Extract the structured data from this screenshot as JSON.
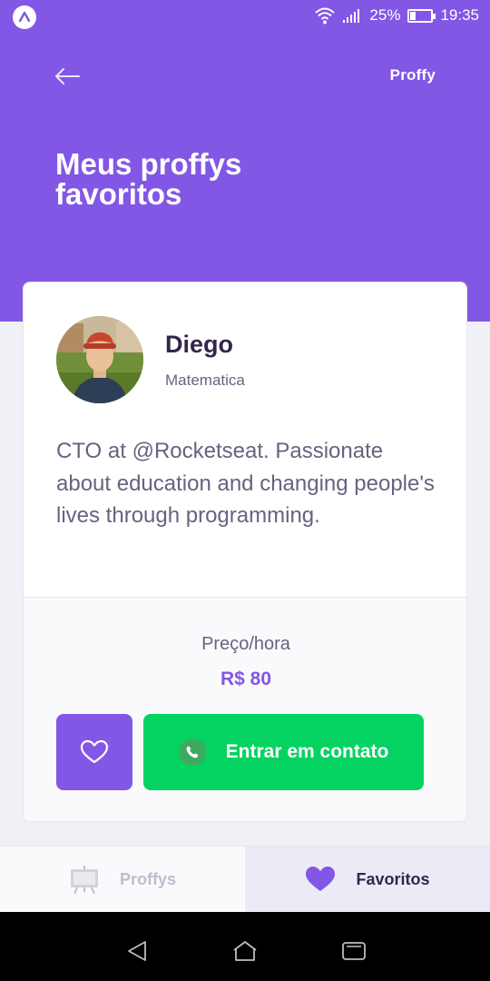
{
  "status_bar": {
    "battery": "25%",
    "time": "19:35"
  },
  "header": {
    "brand": "Proffy",
    "title": "Meus proffys favoritos"
  },
  "teacher": {
    "name": "Diego",
    "subject": "Matematica",
    "bio": "CTO at @Rocketseat. Passionate about education and changing people's lives through programming.",
    "price_label": "Preço/hora",
    "price_value": "R$ 80",
    "contact_label": "Entrar em contato"
  },
  "tabs": [
    {
      "label": "Proffys",
      "icon": "easel-icon",
      "active": false
    },
    {
      "label": "Favoritos",
      "icon": "heart-icon",
      "active": true
    }
  ],
  "colors": {
    "primary": "#8257e5",
    "green": "#04d361",
    "text_title": "#32264d",
    "text_base": "#6a6180"
  }
}
